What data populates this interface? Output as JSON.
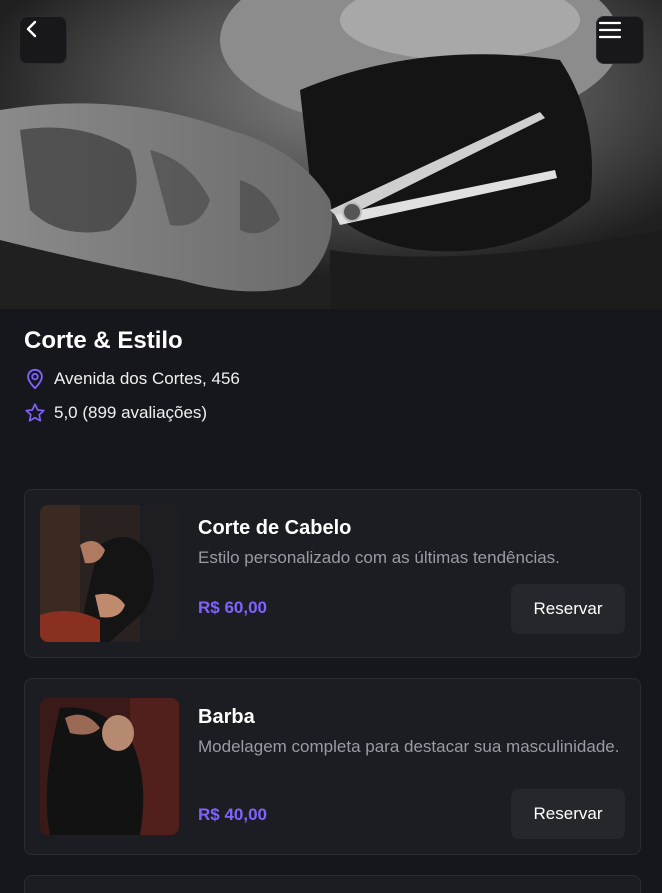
{
  "header": {
    "back_icon": "chevron-left-icon",
    "menu_icon": "hamburger-menu-icon"
  },
  "barbershop": {
    "name": "Corte & Estilo",
    "address": "Avenida dos Cortes, 456",
    "rating": "5,0 (899 avaliações)"
  },
  "services": [
    {
      "name": "Corte de Cabelo",
      "description": "Estilo personalizado com as últimas tendências.",
      "price": "R$ 60,00",
      "button": "Reservar"
    },
    {
      "name": "Barba",
      "description": "Modelagem completa para destacar sua masculinidade.",
      "price": "R$ 40,00",
      "button": "Reservar"
    }
  ],
  "colors": {
    "accent": "#8162ff",
    "background": "#16171c",
    "card": "#1c1d22",
    "muted_text": "#9a9ba4"
  }
}
